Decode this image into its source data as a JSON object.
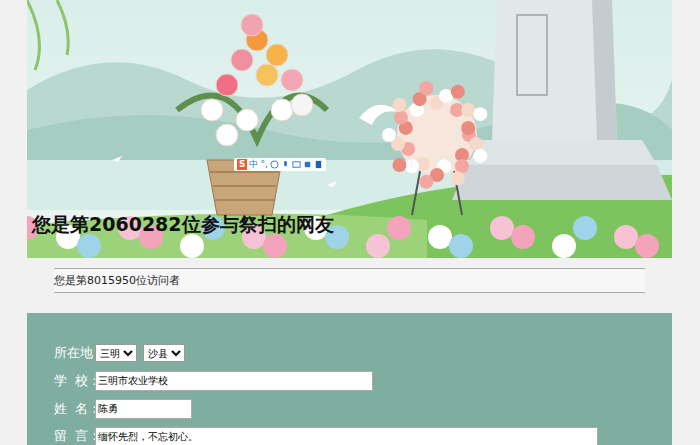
{
  "banner": {
    "caption": "您是第2060282位参与祭扫的网友"
  },
  "ime_toolbar": {
    "logo": "S",
    "mode": "中",
    "punct": "°,"
  },
  "visitor_counter": "您是第8015950位访问者",
  "form": {
    "fields": [
      {
        "label": "所在地：",
        "kind": "select",
        "values": [
          "三明",
          "沙县"
        ]
      },
      {
        "label": "学  校：",
        "kind": "input",
        "value": "三明市农业学校"
      },
      {
        "label": "姓  名：",
        "kind": "input",
        "value": "陈勇"
      },
      {
        "label": "留  言：",
        "kind": "textarea",
        "value": "缅怀先烈，不忘初心。"
      }
    ]
  }
}
